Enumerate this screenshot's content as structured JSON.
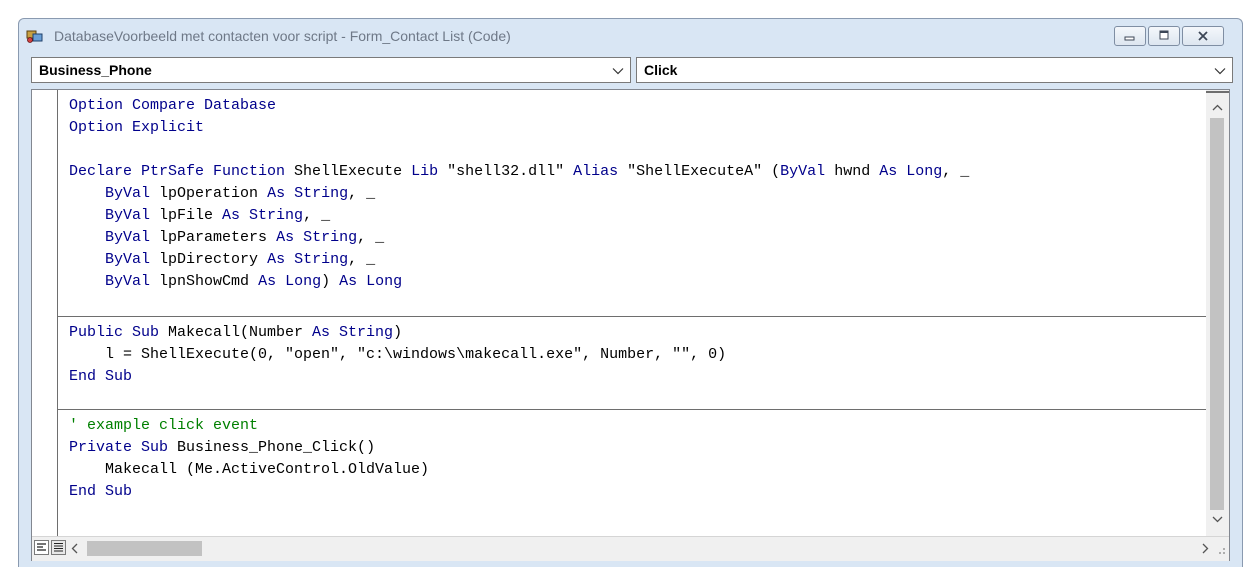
{
  "window": {
    "title": "DatabaseVoorbeeld met contacten voor script - Form_Contact List (Code)",
    "icons": {
      "app": "vba-project-icon",
      "minimize": "minimize-icon",
      "maximize": "maximize-icon",
      "close": "close-icon"
    }
  },
  "object_dropdown": {
    "selected": "Business_Phone"
  },
  "procedure_dropdown": {
    "selected": "Click"
  },
  "code": {
    "blocks": [
      [
        [
          {
            "t": "Option Compare Database",
            "c": "kw"
          }
        ],
        [
          {
            "t": "Option Explicit",
            "c": "kw"
          }
        ],
        [],
        [
          {
            "t": "Declare PtrSafe Function",
            "c": "kw"
          },
          {
            "t": " ShellExecute "
          },
          {
            "t": "Lib",
            "c": "kw"
          },
          {
            "t": " \"shell32.dll\" "
          },
          {
            "t": "Alias",
            "c": "kw"
          },
          {
            "t": " \"ShellExecuteA\" ("
          },
          {
            "t": "ByVal",
            "c": "kw"
          },
          {
            "t": " hwnd "
          },
          {
            "t": "As Long",
            "c": "kw"
          },
          {
            "t": ", _"
          }
        ],
        [
          {
            "t": "    "
          },
          {
            "t": "ByVal",
            "c": "kw"
          },
          {
            "t": " lpOperation "
          },
          {
            "t": "As String",
            "c": "kw"
          },
          {
            "t": ", _"
          }
        ],
        [
          {
            "t": "    "
          },
          {
            "t": "ByVal",
            "c": "kw"
          },
          {
            "t": " lpFile "
          },
          {
            "t": "As String",
            "c": "kw"
          },
          {
            "t": ", _"
          }
        ],
        [
          {
            "t": "    "
          },
          {
            "t": "ByVal",
            "c": "kw"
          },
          {
            "t": " lpParameters "
          },
          {
            "t": "As String",
            "c": "kw"
          },
          {
            "t": ", _"
          }
        ],
        [
          {
            "t": "    "
          },
          {
            "t": "ByVal",
            "c": "kw"
          },
          {
            "t": " lpDirectory "
          },
          {
            "t": "As String",
            "c": "kw"
          },
          {
            "t": ", _"
          }
        ],
        [
          {
            "t": "    "
          },
          {
            "t": "ByVal",
            "c": "kw"
          },
          {
            "t": " lpnShowCmd "
          },
          {
            "t": "As Long",
            "c": "kw"
          },
          {
            "t": ") "
          },
          {
            "t": "As Long",
            "c": "kw"
          }
        ]
      ],
      [
        [
          {
            "t": "Public Sub",
            "c": "kw"
          },
          {
            "t": " Makecall(Number "
          },
          {
            "t": "As String",
            "c": "kw"
          },
          {
            "t": ")"
          }
        ],
        [
          {
            "t": "    l = ShellExecute(0, \"open\", \"c:\\windows\\makecall.exe\", Number, \"\", 0)"
          }
        ],
        [
          {
            "t": "End Sub",
            "c": "kw"
          }
        ]
      ],
      [
        [
          {
            "t": "' example click event",
            "c": "cm"
          }
        ],
        [
          {
            "t": "Private Sub",
            "c": "kw"
          },
          {
            "t": " Business_Phone_Click()"
          }
        ],
        [
          {
            "t": "    Makecall (Me.ActiveControl.OldValue)"
          }
        ],
        [
          {
            "t": "End Sub",
            "c": "kw"
          }
        ]
      ]
    ]
  },
  "view_buttons": {
    "procedure_view": "procedure-view-icon",
    "full_module_view": "full-module-view-icon"
  },
  "colors": {
    "keyword": "#00008b",
    "comment": "#008000",
    "text": "#000000",
    "window_frame": "#d9e6f4"
  }
}
